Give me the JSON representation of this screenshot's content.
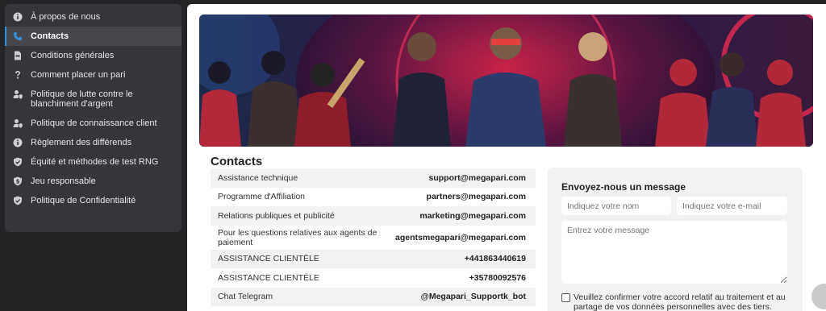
{
  "sidebar": {
    "items": [
      {
        "label": "À propos de nous",
        "icon": "info-icon"
      },
      {
        "label": "Contacts",
        "icon": "phone-icon",
        "active": true
      },
      {
        "label": "Conditions générales",
        "icon": "document-icon"
      },
      {
        "label": "Comment placer un pari",
        "icon": "question-icon"
      },
      {
        "label": "Politique de lutte contre le blanchiment d'argent",
        "icon": "user-shield-icon"
      },
      {
        "label": "Politique de connaissance client",
        "icon": "user-shield-icon"
      },
      {
        "label": "Règlement des différends",
        "icon": "info-icon"
      },
      {
        "label": "Équité et méthodes de test RNG",
        "icon": "shield-check-icon"
      },
      {
        "label": "Jeu responsable",
        "icon": "shield-dollar-icon"
      },
      {
        "label": "Politique de Confidentialité",
        "icon": "shield-check-icon"
      }
    ]
  },
  "main": {
    "title": "Contacts",
    "contacts": [
      {
        "label": "Assistance technique",
        "value": "support@megapari.com"
      },
      {
        "label": "Programme d'Affiliation",
        "value": "partners@megapari.com"
      },
      {
        "label": "Relations publiques et publicité",
        "value": "marketing@megapari.com"
      },
      {
        "label": "Pour les questions relatives aux agents de paiement",
        "value": "agentsmegapari@megapari.com"
      },
      {
        "label": "ASSISTANCE CLIENTÈLE",
        "value": "+441863440619"
      },
      {
        "label": "ASSISTANCE CLIENTÈLE",
        "value": "+35780092576"
      },
      {
        "label": "Chat Telegram",
        "value": "@Megapari_Supportk_bot"
      }
    ]
  },
  "form": {
    "title": "Envoyez-nous un message",
    "name_placeholder": "Indiquez votre nom",
    "email_placeholder": "Indiquez votre e-mail",
    "message_placeholder": "Entrez votre message",
    "consent": "Veuillez confirmer votre accord relatif au traitement et au partage de vos données personnelles avec des tiers."
  },
  "colors": {
    "accent": "#2f8fe0",
    "sidebar_bg": "#35363a",
    "page_bg": "#222325"
  }
}
